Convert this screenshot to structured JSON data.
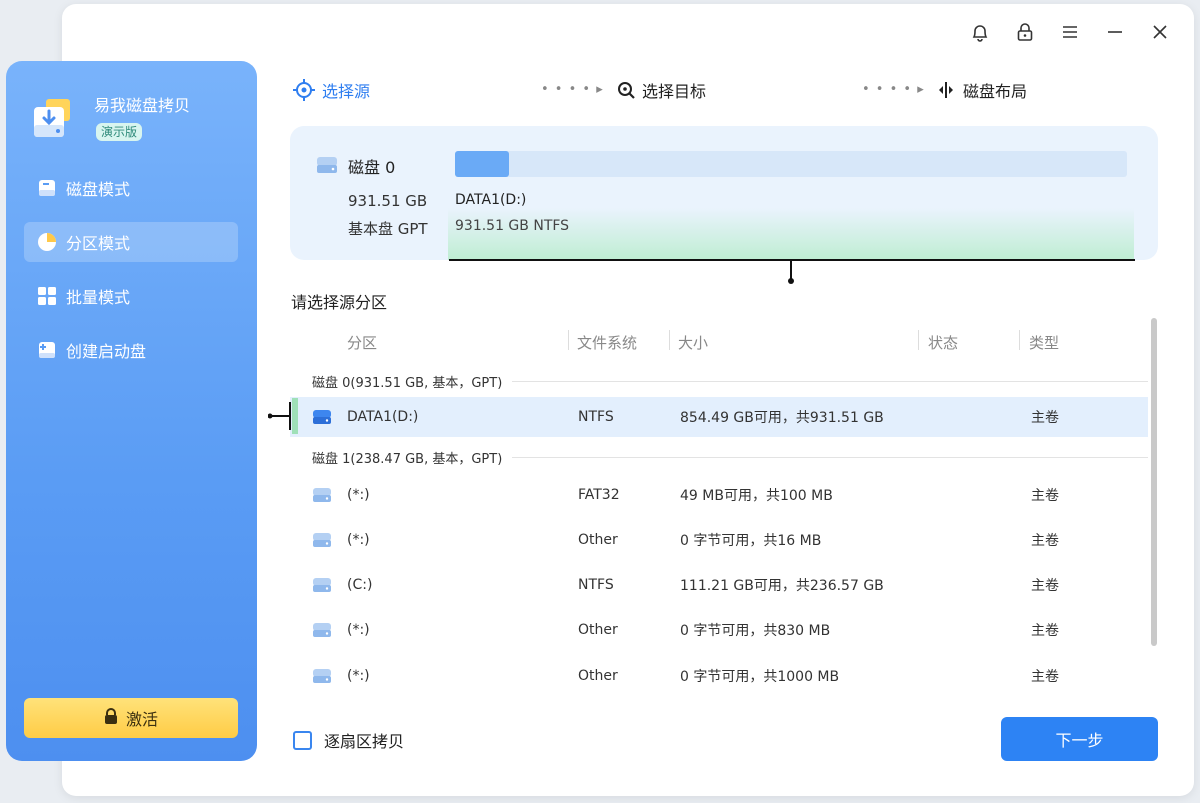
{
  "app": {
    "name": "易我磁盘拷贝",
    "badge": "演示版"
  },
  "sidebar": {
    "items": [
      {
        "label": "磁盘模式",
        "icon": "disk-mode-icon",
        "active": false
      },
      {
        "label": "分区模式",
        "icon": "pie-chart-icon",
        "active": true
      },
      {
        "label": "批量模式",
        "icon": "grid-icon",
        "active": false
      },
      {
        "label": "创建启动盘",
        "icon": "add-disk-icon",
        "active": false
      }
    ],
    "activate_label": "激活"
  },
  "window_controls": [
    "bell-icon",
    "lock-icon",
    "menu-icon",
    "minimize-icon",
    "close-icon"
  ],
  "steps": [
    {
      "label": "选择源",
      "active": true
    },
    {
      "label": "选择目标",
      "active": false
    },
    {
      "label": "磁盘布局",
      "active": false
    }
  ],
  "disk_card": {
    "name": "磁盘 0",
    "size": "931.51 GB",
    "type": "基本盘 GPT",
    "partition_name": "DATA1(D:)",
    "partition_fs": "931.51 GB NTFS",
    "used_fraction": 0.08
  },
  "section_title": "请选择源分区",
  "table": {
    "headers": {
      "partition": "分区",
      "fs": "文件系统",
      "size": "大小",
      "status": "状态",
      "type": "类型"
    },
    "groups": [
      {
        "label": "磁盘 0(931.51 GB, 基本，GPT)",
        "rows": [
          {
            "name": "DATA1(D:)",
            "fs": "NTFS",
            "size": "854.49 GB可用，共931.51 GB",
            "type": "主卷",
            "selected": true
          }
        ]
      },
      {
        "label": "磁盘 1(238.47 GB, 基本，GPT)",
        "rows": [
          {
            "name": "(*:)",
            "fs": "FAT32",
            "size": "49 MB可用，共100 MB",
            "type": "主卷",
            "selected": false
          },
          {
            "name": "(*:)",
            "fs": "Other",
            "size": "0 字节可用，共16 MB",
            "type": "主卷",
            "selected": false
          },
          {
            "name": "(C:)",
            "fs": "NTFS",
            "size": "111.21 GB可用，共236.57 GB",
            "type": "主卷",
            "selected": false
          },
          {
            "name": "(*:)",
            "fs": "Other",
            "size": "0 字节可用，共830 MB",
            "type": "主卷",
            "selected": false
          },
          {
            "name": "(*:)",
            "fs": "Other",
            "size": "0 字节可用，共1000 MB",
            "type": "主卷",
            "selected": false
          }
        ]
      }
    ]
  },
  "sector_copy_label": "逐扇区拷贝",
  "next_label": "下一步",
  "colors": {
    "accent": "#2d83f4",
    "sidebar": "#5a9cf4",
    "activate": "#ffcc45"
  }
}
